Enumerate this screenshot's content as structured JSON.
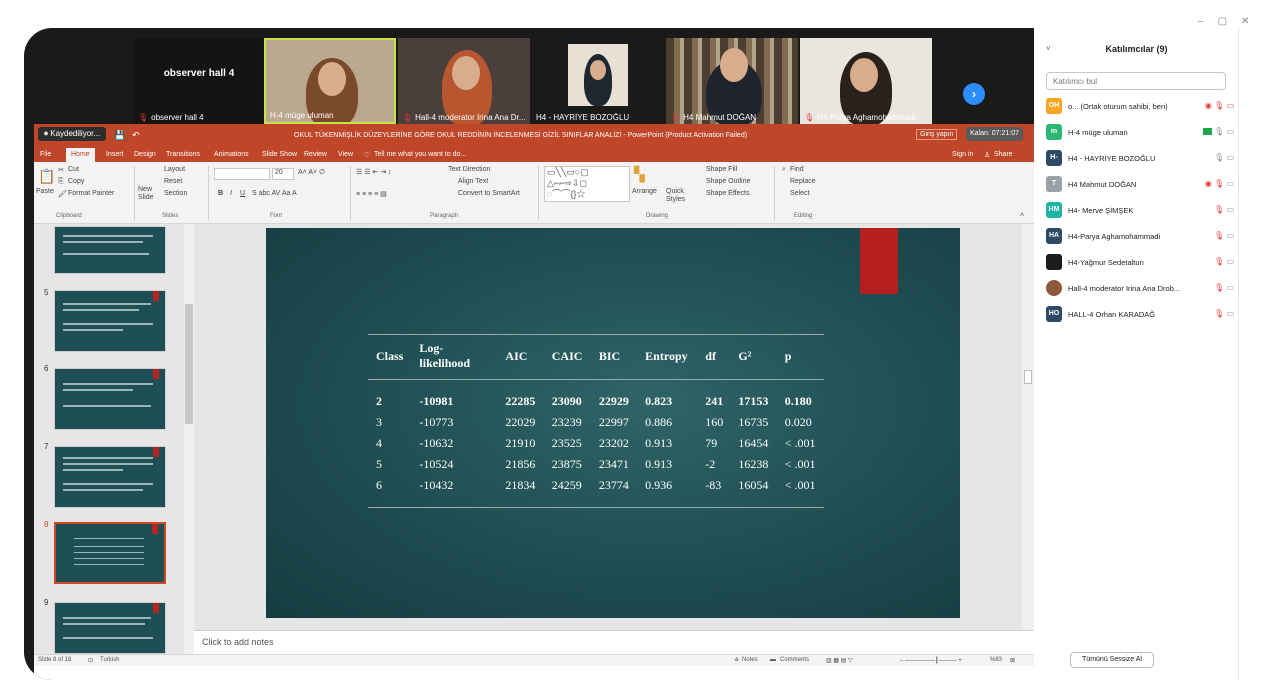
{
  "video_strip": {
    "observer": {
      "big_label": "observer hall 4",
      "name": "observer hall 4"
    },
    "tiles": [
      {
        "name": "H-4 müge uluman"
      },
      {
        "name": "Hall-4 moderator Irina Ana Dr..."
      },
      {
        "name": "H4 - HAYRİYE BOZOĞLU"
      },
      {
        "name": "H4 Mahmut DOĞAN"
      },
      {
        "name": "H4-Parya Aghamohammadi"
      }
    ],
    "next_icon": "chevron-right-circle"
  },
  "ppt": {
    "recording": "Kaydediliyor...",
    "title": "OKUL TÜKENMİŞLİK DÜZEYLERİNE GÖRE OKUL REDDİNİN İNCELENMESİ GİZİL SINIFLAR ANALİZİ - PowerPoint (Product Activation Failed)",
    "login": "Giriş yapın",
    "timer": "Kalan: 07:21:07",
    "tabs": [
      "File",
      "Home",
      "Insert",
      "Design",
      "Transitions",
      "Animations",
      "Slide Show",
      "Review",
      "View"
    ],
    "tell_me": "Tell me what you want to do...",
    "sign_in": "Sign in",
    "share": "Share",
    "ribbon": {
      "paste": "Paste",
      "cut": "Cut",
      "copy": "Copy",
      "format_painter": "Format Painter",
      "clipboard": "Clipboard",
      "new_slide": "New Slide",
      "layout": "Layout",
      "reset": "Reset",
      "section": "Section",
      "slides": "Slides",
      "font_size": "20",
      "font": "Font",
      "paragraph": "Paragraph",
      "text_direction": "Text Direction",
      "align_text": "Align Text",
      "convert_smartart": "Convert to SmartArt",
      "arrange": "Arrange",
      "quick_styles": "Quick Styles",
      "shape_fill": "Shape Fill",
      "shape_outline": "Shape Outline",
      "shape_effects": "Shape Effects",
      "drawing": "Drawing",
      "find": "Find",
      "replace": "Replace",
      "select": "Select",
      "editing": "Editing"
    },
    "thumb_numbers": [
      "5",
      "6",
      "7",
      "8",
      "9"
    ],
    "notes_placeholder": "Click to add notes",
    "status": {
      "slide_info": "Slide 8 of 18",
      "language": "Turkish",
      "notes": "Notes",
      "comments": "Comments",
      "zoom": "%83"
    },
    "table": {
      "headers": [
        "Class",
        "Log-likelihood",
        "AIC",
        "CAIC",
        "BIC",
        "Entropy",
        "df",
        "G²",
        "p"
      ],
      "rows": [
        [
          "2",
          "-10981",
          "22285",
          "23090",
          "22929",
          "0.823",
          "241",
          "17153",
          "0.180"
        ],
        [
          "3",
          "-10773",
          "22029",
          "23239",
          "22997",
          "0.886",
          "160",
          "16735",
          "0.020"
        ],
        [
          "4",
          "-10632",
          "21910",
          "23525",
          "23202",
          "0.913",
          "79",
          "16454",
          "< .001"
        ],
        [
          "5",
          "-10524",
          "21856",
          "23875",
          "23471",
          "0.913",
          "-2",
          "16238",
          "< .001"
        ],
        [
          "6",
          "-10432",
          "21834",
          "24259",
          "23774",
          "0.936",
          "-83",
          "16054",
          "< .001"
        ]
      ]
    }
  },
  "panel": {
    "title": "Katılımcılar (9)",
    "search_placeholder": "Katılımcı bul",
    "participants": [
      {
        "initials": "OH",
        "color": "#f5a623",
        "name": "o... (Ortak oturum sahibi, ben)"
      },
      {
        "initials": "m",
        "color": "#2bb673",
        "name": "H-4 müge uluman"
      },
      {
        "initials": "H-",
        "color": "#2f4a66",
        "name": "H4 - HAYRİYE BOZOĞLU"
      },
      {
        "initials": "T",
        "color": "#9aa0a6",
        "name": "H4 Mahmut DOĞAN"
      },
      {
        "initials": "HM",
        "color": "#1fb5a6",
        "name": "H4- Merve ŞİMŞEK"
      },
      {
        "initials": "HA",
        "color": "#2f4a66",
        "name": "H4-Parya Aghamohammadi"
      },
      {
        "initials": "",
        "color": "#1c1c1c",
        "name": "H4-Yağmur Sedetaltun"
      },
      {
        "initials": "",
        "color": "#8d5a3c",
        "name": "Hall-4 moderator Irina Ana Drob..."
      },
      {
        "initials": "HO",
        "color": "#2f4a66",
        "name": "HALL-4 Orhan KARADAĞ"
      }
    ],
    "mute_all": "Tümünü Sessize Al"
  }
}
